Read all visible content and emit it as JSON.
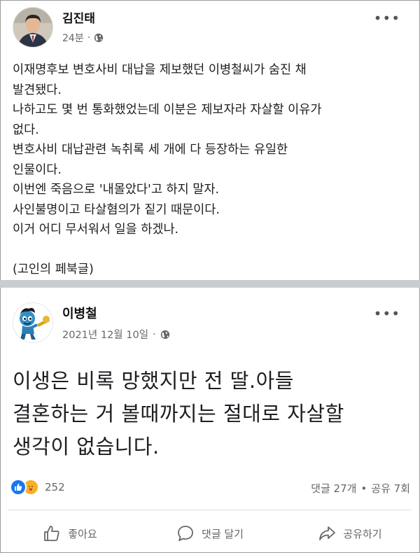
{
  "post1": {
    "author": "김진태",
    "time": "24분",
    "more_icon": "more-horizontal-icon",
    "privacy_icon": "globe-icon",
    "lines": [
      "이재명후보 변호사비 대납을 제보했던 이병철씨가 숨진 채",
      "발견됐다.",
      "나하고도 몇 번 통화했었는데 이분은 제보자라 자살할 이유가",
      "없다.",
      "변호사비 대납관련 녹취록 세 개에 다 등장하는 유일한",
      "인물이다.",
      "이번엔 죽음으로 '내몰았다'고 하지 말자.",
      "사인불명이고 타살혐의가 짙기 때문이다.",
      "이거 어디 무서워서 일을 하겠나."
    ],
    "footer_line": "(고인의 페북글)"
  },
  "post2": {
    "author": "이병철",
    "date": "2021년 12월 10일",
    "dot": "·",
    "privacy_icon": "globe-icon",
    "lines": [
      "이생은 비록 망했지만 전 딸.아들",
      "결혼하는 거 볼때까지는 절대로 자살할",
      "생각이 없습니다."
    ],
    "reaction_count": "252",
    "comments": "댓글 27개",
    "separator": "•",
    "shares": "공유 7회",
    "actions": {
      "like": "좋아요",
      "comment": "댓글 달기",
      "share": "공유하기"
    }
  },
  "colors": {
    "accent": "#1877f2",
    "divider": "#c9ccd1",
    "meta_text": "#65676b"
  }
}
